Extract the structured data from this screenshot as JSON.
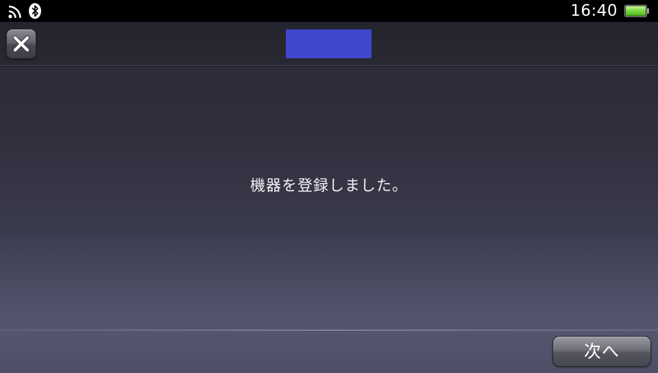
{
  "status_bar": {
    "time": "16:40",
    "icons": [
      "wifi-icon",
      "bluetooth-icon",
      "battery-icon"
    ],
    "battery_color": "#6fd23a"
  },
  "title_bar": {
    "close_icon": "close-icon",
    "title_block_color": "#3f48cc"
  },
  "main": {
    "message": "機器を登録しました。"
  },
  "footer": {
    "next_label": "次へ"
  }
}
